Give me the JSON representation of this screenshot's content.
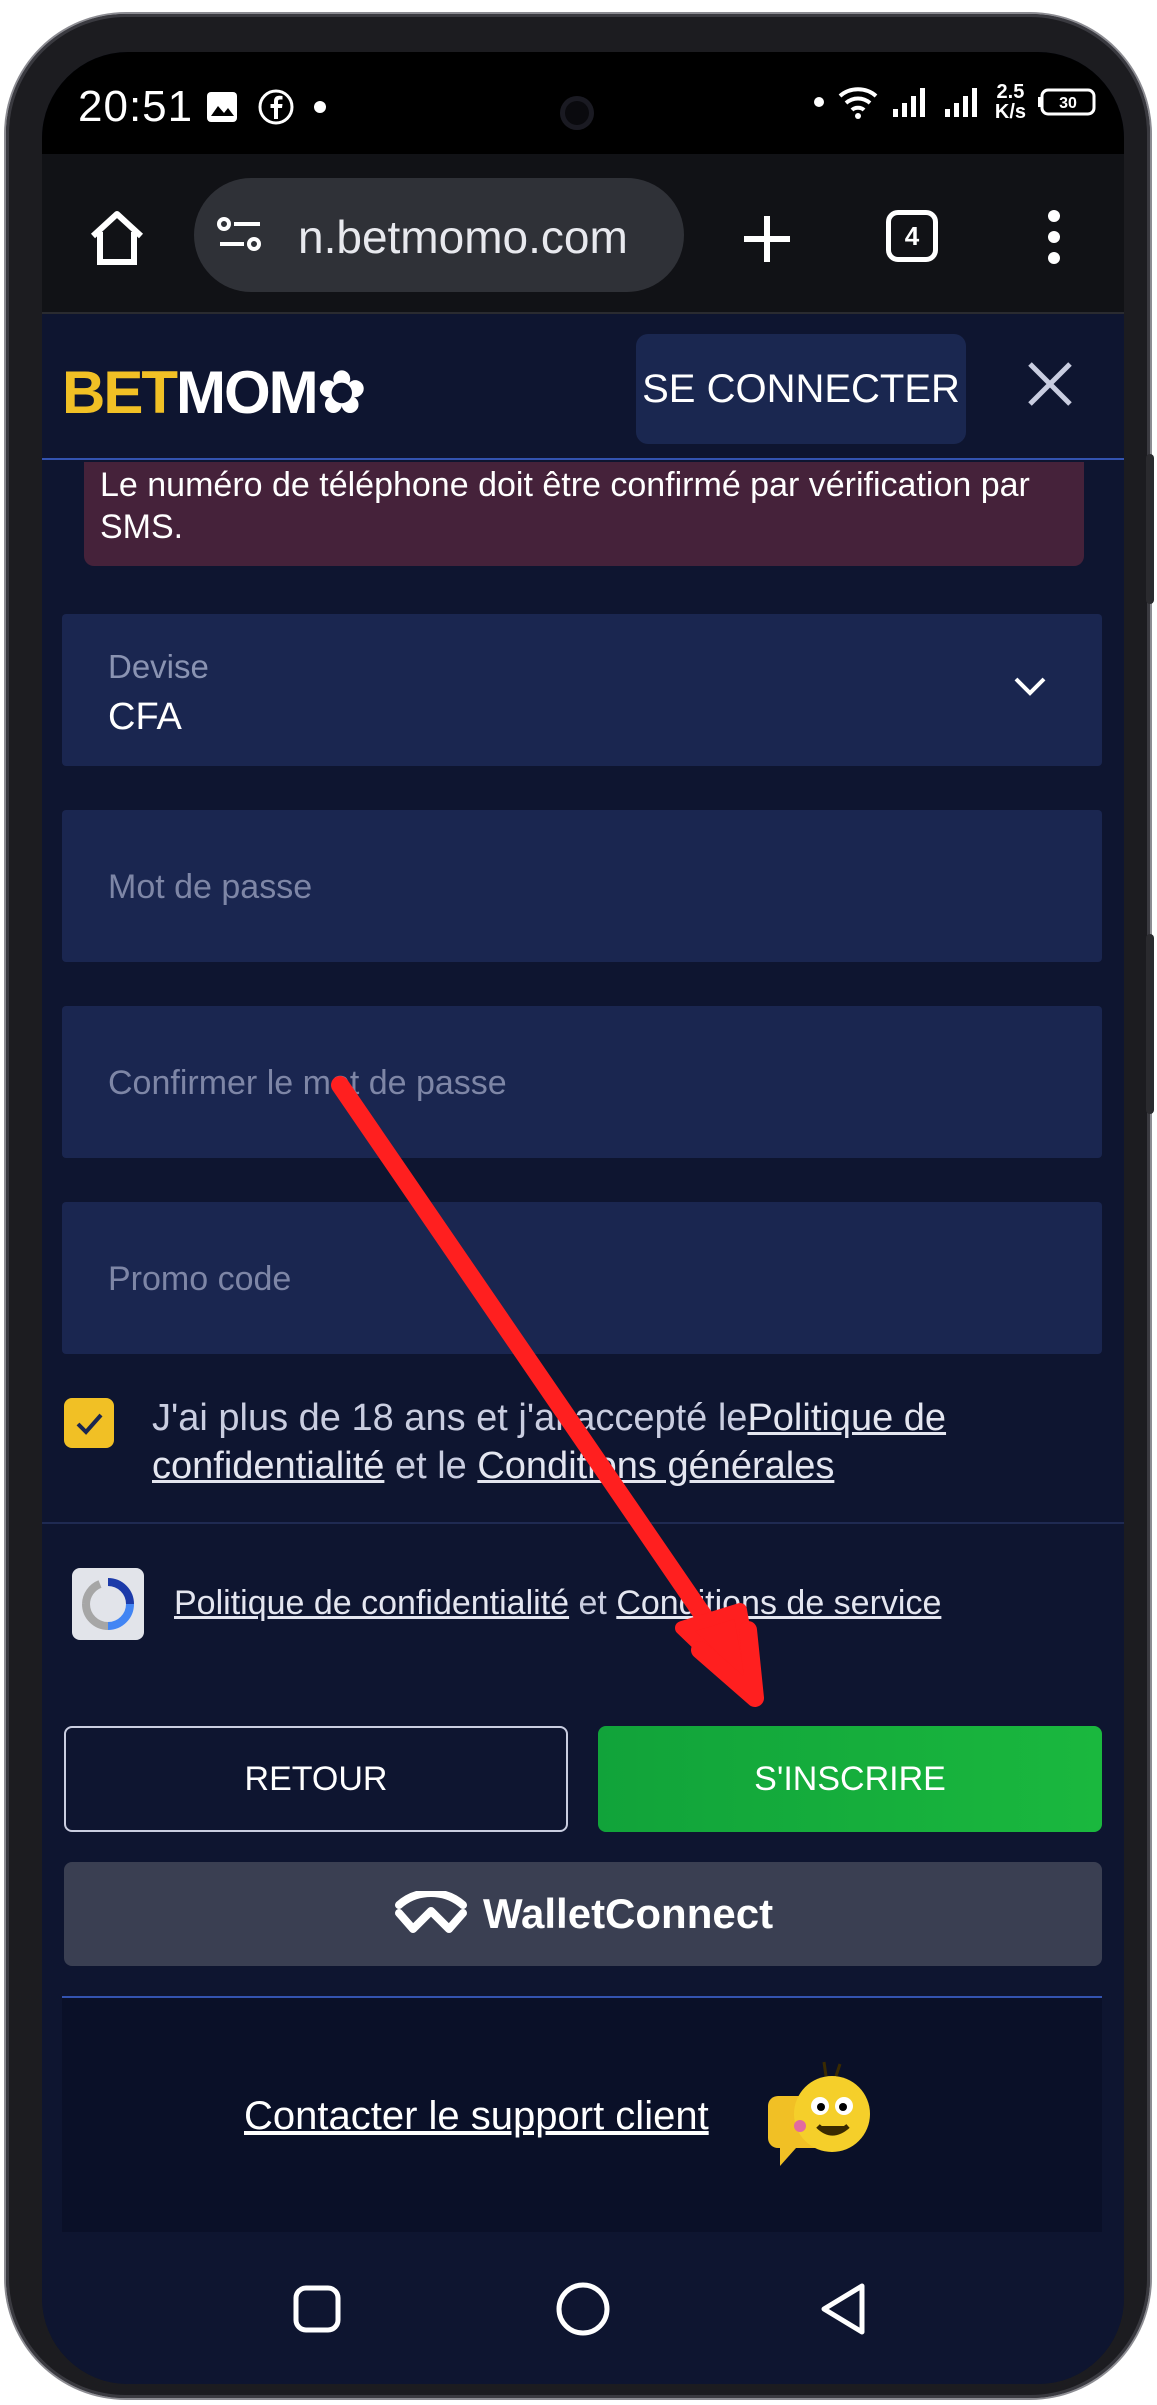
{
  "status": {
    "time": "20:51",
    "speed_value": "2.5",
    "speed_unit": "K/s",
    "battery": "30"
  },
  "browser": {
    "url": "n.betmomo.com",
    "tab_count": "4"
  },
  "header": {
    "logo_bet": "BET",
    "logo_momo": "MOM",
    "login_label": "SE CONNECTER"
  },
  "form": {
    "alert": "Le numéro de téléphone doit être confirmé par vérification par SMS.",
    "currency": {
      "label": "Devise",
      "value": "CFA"
    },
    "password_placeholder": "Mot de passe",
    "confirm_placeholder": "Confirmer le mot de passe",
    "promo_placeholder": "Promo code",
    "terms_prefix": "J'ai plus de 18 ans et j'ai accepté le",
    "terms_privacy": "Politique de confidentialité",
    "terms_and": " et le ",
    "terms_conditions": "Conditions générales",
    "recaptcha_privacy": "Politique de confidentialité",
    "recaptcha_and": " et ",
    "recaptcha_terms": "Conditions de service",
    "back_label": "RETOUR",
    "register_label": "S'INSCRIRE",
    "wallet_label": "WalletConnect"
  },
  "support": {
    "link": "Contacter le support client"
  },
  "colors": {
    "brand_yellow": "#f1c025",
    "register_green": "#15a83a",
    "page_bg": "#0e1530",
    "field_bg": "#1a2650",
    "annotation_arrow": "#ff1f1f"
  }
}
